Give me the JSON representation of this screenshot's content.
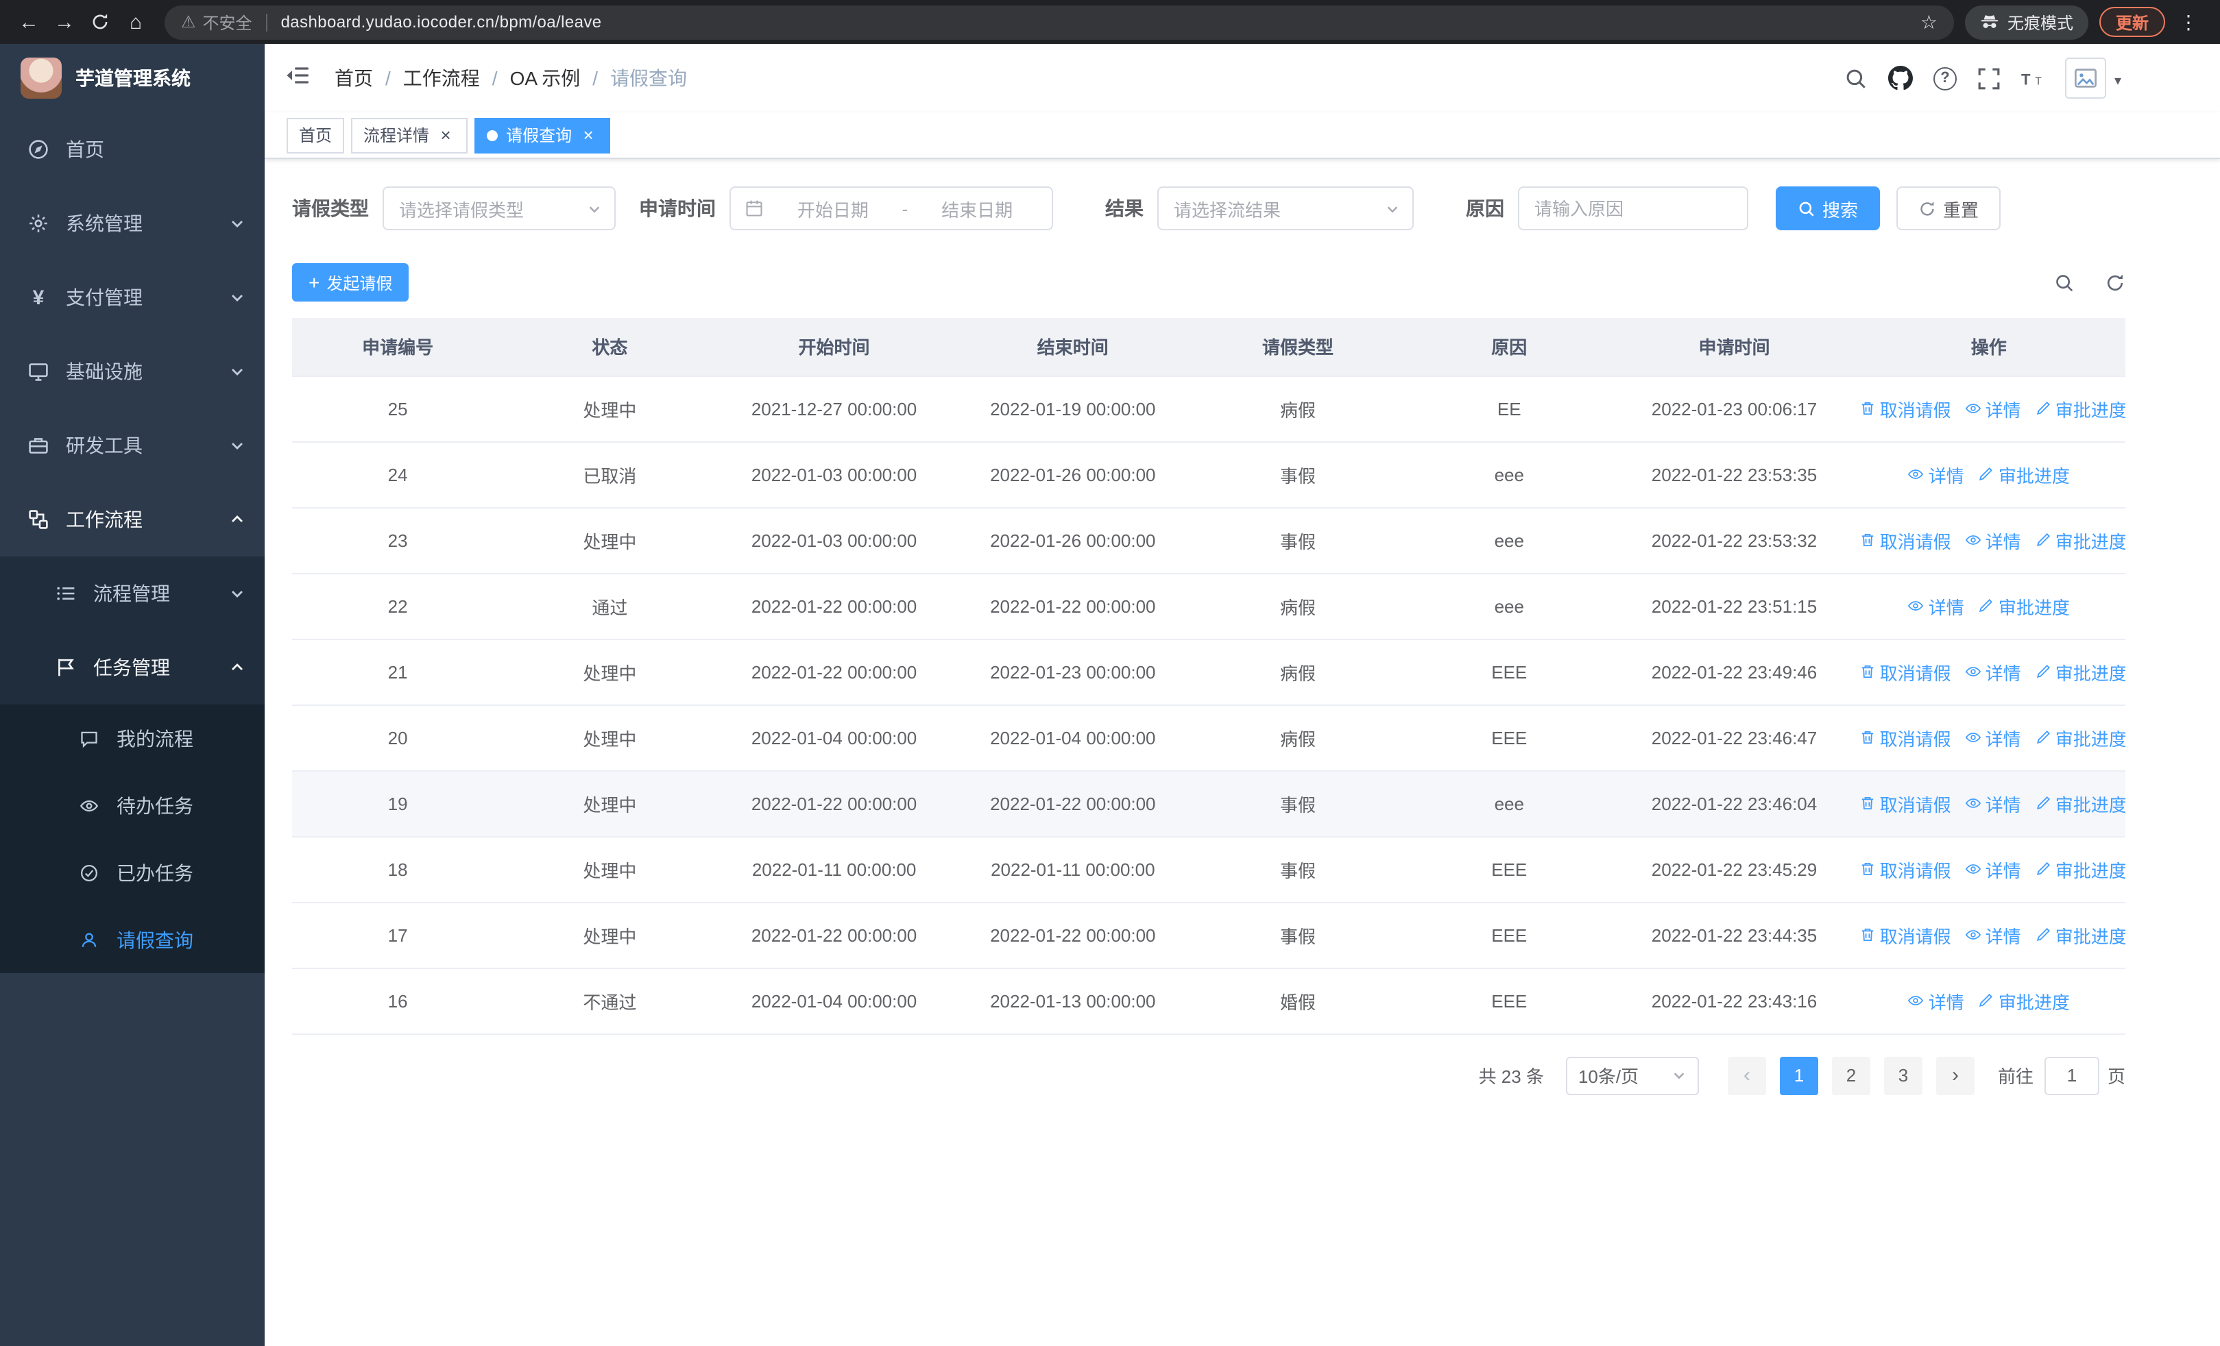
{
  "browser": {
    "security_label": "不安全",
    "url": "dashboard.yudao.iocoder.cn/bpm/oa/leave",
    "incognito_label": "无痕模式",
    "update_label": "更新"
  },
  "icons": {
    "back": "←",
    "forward": "→",
    "home": "⌂",
    "warning": "⚠",
    "star": "☆",
    "menu_dots": "⋮",
    "close": "×",
    "prev": "‹",
    "next": "›",
    "plus": "+",
    "caret": "▾",
    "range_separator": "-",
    "breadcrumb_sep": "/",
    "question": "?"
  },
  "sidebar": {
    "logo_title": "芋道管理系统",
    "items": [
      {
        "label": "首页"
      },
      {
        "label": "系统管理"
      },
      {
        "label": "支付管理"
      },
      {
        "label": "基础设施"
      },
      {
        "label": "研发工具"
      },
      {
        "label": "工作流程"
      }
    ],
    "workflow_children": [
      {
        "label": "流程管理"
      },
      {
        "label": "任务管理"
      }
    ],
    "task_children": [
      {
        "label": "我的流程"
      },
      {
        "label": "待办任务"
      },
      {
        "label": "已办任务"
      },
      {
        "label": "请假查询"
      }
    ]
  },
  "header": {
    "breadcrumb": [
      "首页",
      "工作流程",
      "OA 示例",
      "请假查询"
    ]
  },
  "tabs": [
    {
      "label": "首页"
    },
    {
      "label": "流程详情"
    },
    {
      "label": "请假查询"
    }
  ],
  "filters": {
    "leave_type_label": "请假类型",
    "leave_type_placeholder": "请选择请假类型",
    "apply_time_label": "申请时间",
    "start_date_placeholder": "开始日期",
    "end_date_placeholder": "结束日期",
    "result_label": "结果",
    "result_placeholder": "请选择流结果",
    "reason_label": "原因",
    "reason_placeholder": "请输入原因",
    "search_label": "搜索",
    "reset_label": "重置"
  },
  "toolbar": {
    "create_label": "发起请假"
  },
  "table": {
    "columns": [
      "申请编号",
      "状态",
      "开始时间",
      "结束时间",
      "请假类型",
      "原因",
      "申请时间",
      "操作"
    ],
    "column_keys": [
      "id",
      "status",
      "start",
      "end",
      "type",
      "reason",
      "apply"
    ],
    "actions": {
      "cancel": "取消请假",
      "detail": "详情",
      "progress": "审批进度"
    },
    "rows": [
      {
        "id": "25",
        "status": "处理中",
        "start": "2021-12-27 00:00:00",
        "end": "2022-01-19 00:00:00",
        "type": "病假",
        "reason": "EE",
        "apply": "2022-01-23 00:06:17",
        "cancelable": true,
        "hover": false
      },
      {
        "id": "24",
        "status": "已取消",
        "start": "2022-01-03 00:00:00",
        "end": "2022-01-26 00:00:00",
        "type": "事假",
        "reason": "eee",
        "apply": "2022-01-22 23:53:35",
        "cancelable": false,
        "hover": false
      },
      {
        "id": "23",
        "status": "处理中",
        "start": "2022-01-03 00:00:00",
        "end": "2022-01-26 00:00:00",
        "type": "事假",
        "reason": "eee",
        "apply": "2022-01-22 23:53:32",
        "cancelable": true,
        "hover": false
      },
      {
        "id": "22",
        "status": "通过",
        "start": "2022-01-22 00:00:00",
        "end": "2022-01-22 00:00:00",
        "type": "病假",
        "reason": "eee",
        "apply": "2022-01-22 23:51:15",
        "cancelable": false,
        "hover": false
      },
      {
        "id": "21",
        "status": "处理中",
        "start": "2022-01-22 00:00:00",
        "end": "2022-01-23 00:00:00",
        "type": "病假",
        "reason": "EEE",
        "apply": "2022-01-22 23:49:46",
        "cancelable": true,
        "hover": false
      },
      {
        "id": "20",
        "status": "处理中",
        "start": "2022-01-04 00:00:00",
        "end": "2022-01-04 00:00:00",
        "type": "病假",
        "reason": "EEE",
        "apply": "2022-01-22 23:46:47",
        "cancelable": true,
        "hover": false
      },
      {
        "id": "19",
        "status": "处理中",
        "start": "2022-01-22 00:00:00",
        "end": "2022-01-22 00:00:00",
        "type": "事假",
        "reason": "eee",
        "apply": "2022-01-22 23:46:04",
        "cancelable": true,
        "hover": true
      },
      {
        "id": "18",
        "status": "处理中",
        "start": "2022-01-11 00:00:00",
        "end": "2022-01-11 00:00:00",
        "type": "事假",
        "reason": "EEE",
        "apply": "2022-01-22 23:45:29",
        "cancelable": true,
        "hover": false
      },
      {
        "id": "17",
        "status": "处理中",
        "start": "2022-01-22 00:00:00",
        "end": "2022-01-22 00:00:00",
        "type": "事假",
        "reason": "EEE",
        "apply": "2022-01-22 23:44:35",
        "cancelable": true,
        "hover": false
      },
      {
        "id": "16",
        "status": "不通过",
        "start": "2022-01-04 00:00:00",
        "end": "2022-01-13 00:00:00",
        "type": "婚假",
        "reason": "EEE",
        "apply": "2022-01-22 23:43:16",
        "cancelable": false,
        "hover": false
      }
    ]
  },
  "pagination": {
    "total_label": "共 23 条",
    "page_size": "10条/页",
    "pages": [
      "1",
      "2",
      "3"
    ],
    "goto_label": "前往",
    "goto_value": "1",
    "page_label": "页"
  }
}
